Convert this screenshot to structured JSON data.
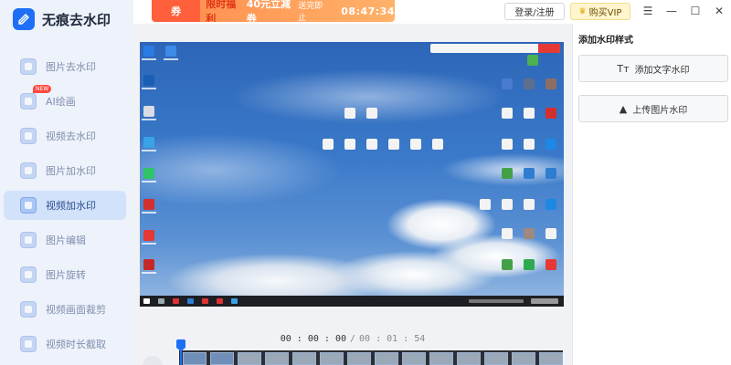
{
  "app": {
    "title": "无痕去水印"
  },
  "sidebar": {
    "items": [
      {
        "label": "图片去水印",
        "icon": "image-remove-icon"
      },
      {
        "label": "AI绘画",
        "icon": "ai-paint-icon",
        "badge": "NEW"
      },
      {
        "label": "视频去水印",
        "icon": "video-remove-icon"
      },
      {
        "label": "图片加水印",
        "icon": "image-add-icon"
      },
      {
        "label": "视频加水印",
        "icon": "video-add-icon",
        "active": true
      },
      {
        "label": "图片编辑",
        "icon": "image-edit-icon"
      },
      {
        "label": "图片旋转",
        "icon": "image-rotate-icon"
      },
      {
        "label": "视频画面裁剪",
        "icon": "video-crop-icon"
      },
      {
        "label": "视频时长截取",
        "icon": "video-trim-icon"
      }
    ]
  },
  "topbar": {
    "promo": {
      "coupon": "券",
      "title": "限时福利",
      "amount": "40元立减券",
      "sub": "送完即止",
      "countdown": "08:47:34"
    },
    "login_label": "登录/注册",
    "vip_label": "购买VIP",
    "menu_glyph": "☰",
    "minimize_glyph": "—",
    "maximize_glyph": "☐",
    "close_glyph": "✕"
  },
  "player": {
    "current_time": "00 : 00 : 00",
    "separator": "/",
    "total_time": "00 : 01 : 54"
  },
  "right_panel": {
    "title": "添加水印样式",
    "add_text_label": "添加文字水印",
    "add_text_icon_glyph": "Tт",
    "upload_image_label": "上传图片水印",
    "upload_image_icon_glyph": "▲"
  },
  "colors": {
    "accent": "#1e6ff5",
    "sidebar_bg": "#eef2fb",
    "active_bg": "#d3e2fb",
    "promo": "#ff8a4c"
  }
}
